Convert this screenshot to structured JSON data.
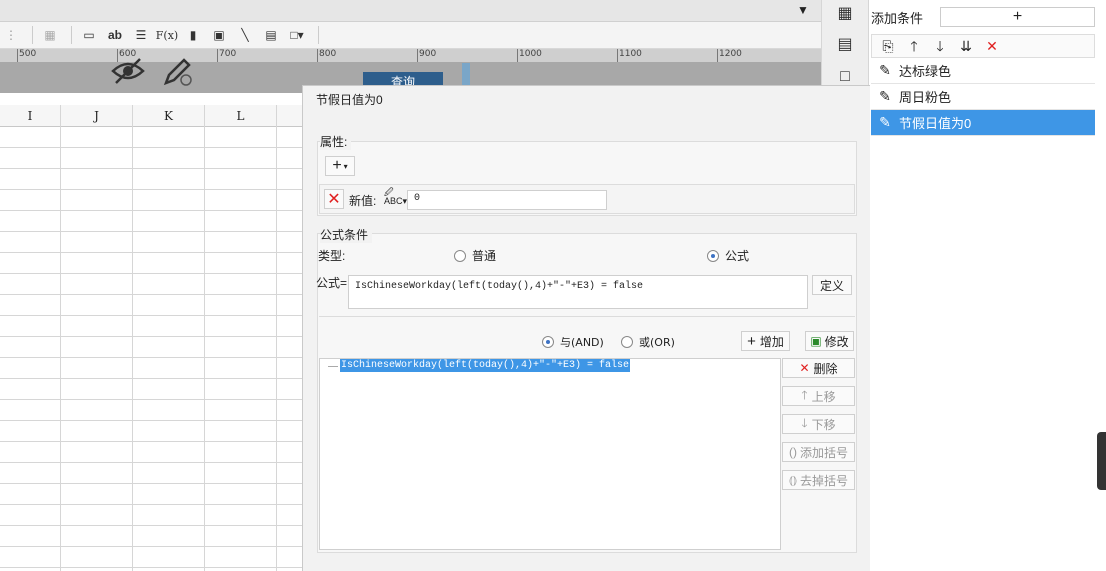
{
  "ruler": {
    "ticks": [
      "500",
      "600",
      "700",
      "800",
      "900",
      "1000",
      "1100",
      "1200"
    ]
  },
  "toolbar": {
    "formula_label": "F(x)",
    "text_label": "ab"
  },
  "design": {
    "query_button": "查询"
  },
  "grid": {
    "columns": [
      "I",
      "J",
      "K",
      "L"
    ]
  },
  "conditions_panel": {
    "add_label": "添加条件",
    "add_button": "+",
    "items": [
      {
        "label": "达标绿色",
        "selected": false
      },
      {
        "label": "周日粉色",
        "selected": false
      },
      {
        "label": "节假日值为0",
        "selected": true
      }
    ]
  },
  "dialog": {
    "title": "节假日值为0",
    "properties": {
      "label": "属性:",
      "add_button": "+",
      "new_value_label": "新值:",
      "new_value": "0"
    },
    "formula_condition": {
      "label": "公式条件",
      "type_label": "类型:",
      "type_options": [
        "普通",
        "公式"
      ],
      "selected_type": "公式",
      "formula_label": "公式=",
      "formula_value": "IsChineseWorkday(left(today(),4)+\"-\"+E3) = false",
      "define_button": "定义",
      "logic_and": "与(AND)",
      "logic_or": "或(OR)",
      "add_button": "增加",
      "modify_button": "修改",
      "delete_button": "删除",
      "up_button": "上移",
      "down_button": "下移",
      "add_bracket_button": "添加括号",
      "remove_bracket_button": "去掉括号",
      "conditions": [
        "IsChineseWorkday(left(today(),4)+\"-\"+E3) = false"
      ]
    }
  },
  "colors": {
    "selection_blue": "#3e96e6",
    "query_button_bg": "#2e5e8c",
    "delete_red": "#e02020"
  }
}
